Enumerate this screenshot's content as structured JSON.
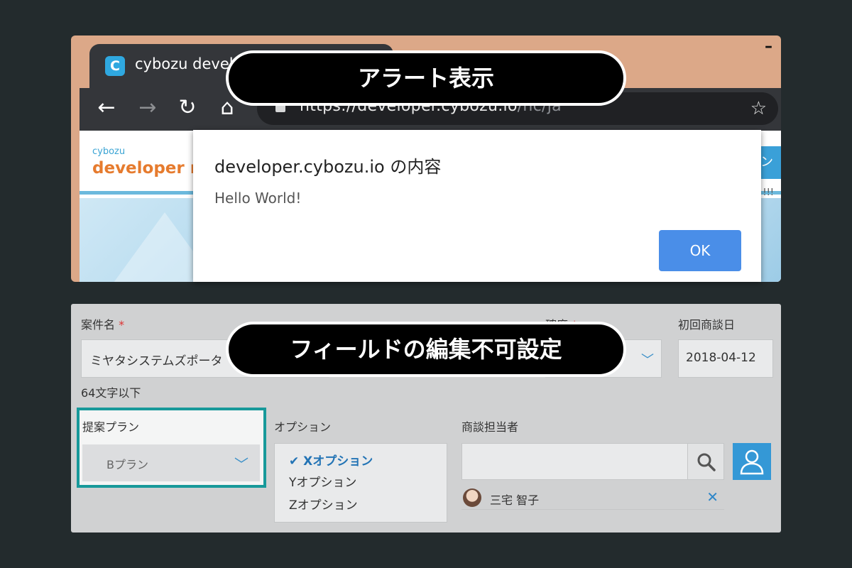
{
  "browser": {
    "tab_title": "cybozu developer",
    "favicon_letter": "C",
    "url_host": "https://developer.cybozu.io",
    "url_path": "/hc/ja",
    "site_logo_small": "cybozu",
    "site_logo_big": "developer ne",
    "side_button_text": "ン",
    "side_text": "!!!"
  },
  "alert": {
    "title": "developer.cybozu.io の内容",
    "message": "Hello World!",
    "ok_label": "OK"
  },
  "form": {
    "name_label": "案件名",
    "name_value": "ミヤタシステムズポータ",
    "name_hint": "64文字以下",
    "probability_label": "確度",
    "date_label": "初回商談日",
    "date_value": "2018-04-12",
    "plan_label": "提案プラン",
    "plan_value": "Bプラン",
    "options_label": "オプション",
    "options": [
      "Xオプション",
      "Yオプション",
      "Zオプション"
    ],
    "options_checkmark": "✔",
    "rep_label": "商談担当者",
    "rep_name": "三宅 智子",
    "required_mark": "*"
  },
  "pills": {
    "alert": "アラート表示",
    "field": "フィールドの編集不可設定"
  },
  "colors": {
    "background": "#232b2d",
    "browser_frame": "#dca888",
    "ok_button": "#4a8ee8",
    "highlight_border": "#17999a",
    "accent_blue": "#3498d6"
  }
}
